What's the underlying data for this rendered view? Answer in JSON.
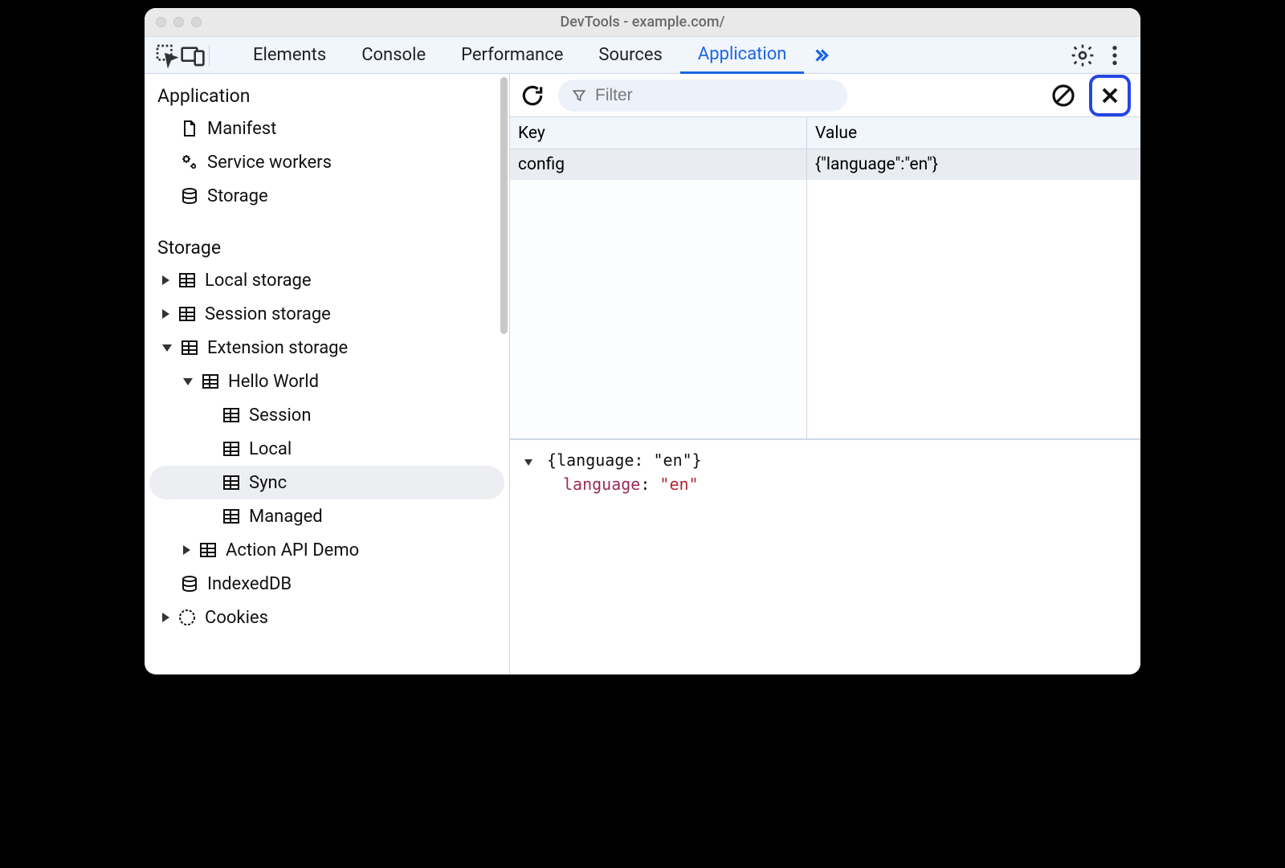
{
  "window": {
    "title": "DevTools - example.com/"
  },
  "tabs": {
    "items": [
      "Elements",
      "Console",
      "Performance",
      "Sources",
      "Application"
    ],
    "active": "Application"
  },
  "sidebar": {
    "sections": {
      "application": {
        "header": "Application",
        "items": [
          "Manifest",
          "Service workers",
          "Storage"
        ]
      },
      "storage": {
        "header": "Storage",
        "local": "Local storage",
        "session": "Session storage",
        "extension": "Extension storage",
        "hello": "Hello World",
        "children": [
          "Session",
          "Local",
          "Sync",
          "Managed"
        ],
        "actionapi": "Action API Demo",
        "indexeddb": "IndexedDB",
        "cookies": "Cookies"
      }
    }
  },
  "toolbar": {
    "filter_placeholder": "Filter"
  },
  "table": {
    "headers": {
      "key": "Key",
      "value": "Value"
    },
    "row": {
      "key": "config",
      "value": "{\"language\":\"en\"}"
    }
  },
  "preview": {
    "summary": "{language: \"en\"}",
    "prop_key": "language",
    "prop_sep": ": ",
    "prop_val": "\"en\""
  }
}
